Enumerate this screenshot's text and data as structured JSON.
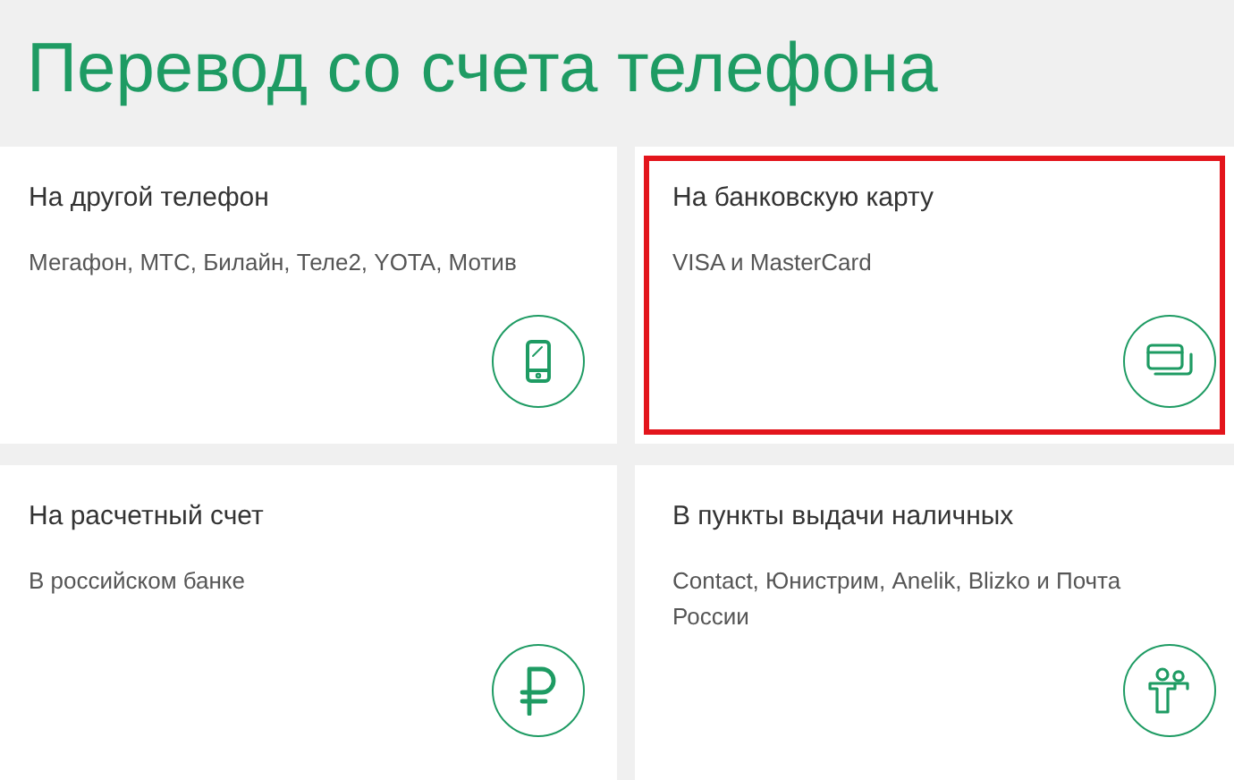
{
  "title": "Перевод со счета телефона",
  "cards": [
    {
      "title": "На другой телефон",
      "subtitle": "Мегафон, МТС, Билайн, Теле2, YOTA, Мотив",
      "kind": "phone",
      "highlighted": false
    },
    {
      "title": "На банковскую карту",
      "subtitle": "VISA и MasterCard",
      "kind": "card",
      "highlighted": true
    },
    {
      "title": "На расчетный счет",
      "subtitle": "В российском банке",
      "kind": "ruble",
      "highlighted": false
    },
    {
      "title": "В пункты выдачи наличных",
      "subtitle": "Contact, Юнистрим, Anelik, Blizko и Почта России",
      "kind": "people",
      "highlighted": false
    }
  ]
}
